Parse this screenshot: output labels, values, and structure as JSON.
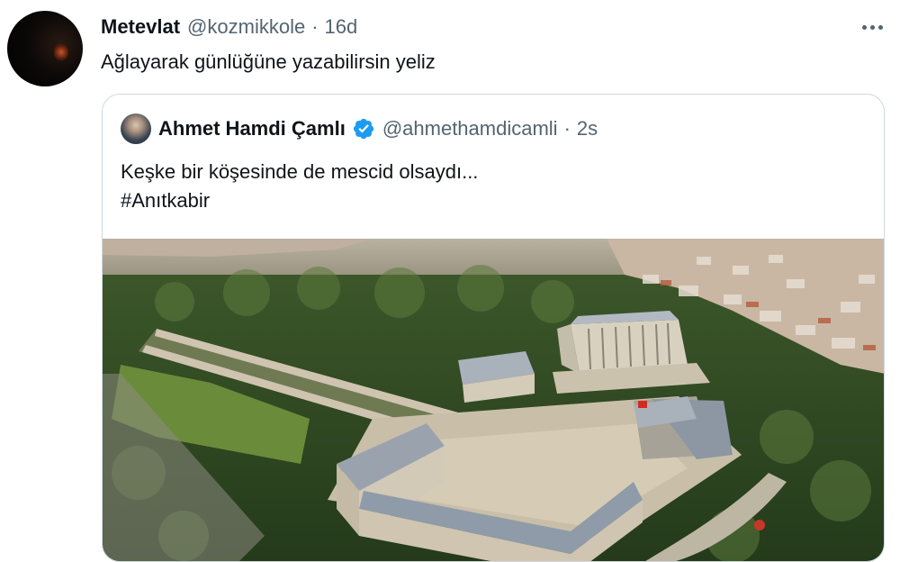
{
  "tweet": {
    "author_name": "Metevlat",
    "author_handle": "@kozmikkole",
    "separator": "·",
    "time": "16d",
    "text": "Ağlayarak günlüğüne yazabilirsin yeliz"
  },
  "quoted_tweet": {
    "author_name": "Ahmet Hamdi Çamlı",
    "author_handle": "@ahmethamdicamli",
    "separator": "·",
    "time": "2s",
    "text_line1": "Keşke bir köşesinde de mescid olsaydı...",
    "text_line2": "#Anıtkabir",
    "verified": true
  },
  "colors": {
    "text": "#0f1419",
    "secondary": "#536471",
    "border": "#cfd9de",
    "verified_blue": "#1d9bf0"
  },
  "icons": {
    "more": "more-horizontal-icon",
    "verified": "verified-badge-icon"
  }
}
